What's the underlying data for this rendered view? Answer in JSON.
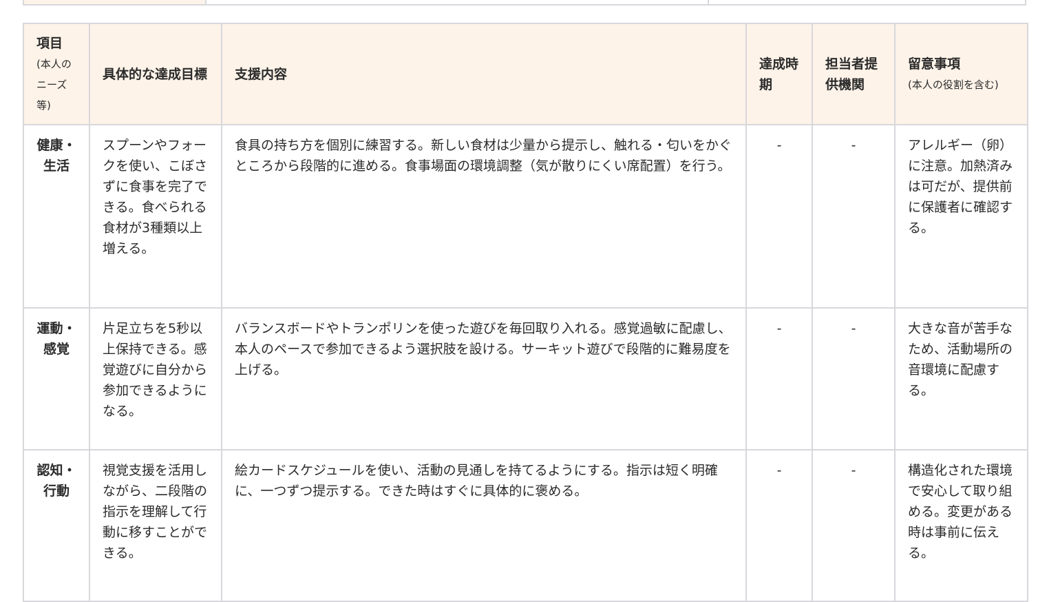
{
  "headers": {
    "item": "項目",
    "item_sub": "(本人のニーズ等)",
    "goal": "具体的な達成目標",
    "support": "支援内容",
    "period": "達成時期",
    "provider": "担当者提供機関",
    "notes": "留意事項",
    "notes_sub": "(本人の役割を含む)"
  },
  "rows": [
    {
      "item": "健康・生活",
      "goal": "スプーンやフォークを使い、こぼさずに食事を完了できる。食べられる食材が3種類以上増える。",
      "support": "食具の持ち方を個別に練習する。新しい食材は少量から提示し、触れる・匂いをかぐところから段階的に進める。食事場面の環境調整（気が散りにくい席配置）を行う。",
      "period": "-",
      "provider": "-",
      "notes": "アレルギー（卵）に注意。加熱済みは可だが、提供前に保護者に確認する。"
    },
    {
      "item": "運動・感覚",
      "goal": "片足立ちを5秒以上保持できる。感覚遊びに自分から参加できるようになる。",
      "support": "バランスボードやトランポリンを使った遊びを毎回取り入れる。感覚過敏に配慮し、本人のペースで参加できるよう選択肢を設ける。サーキット遊びで段階的に難易度を上げる。",
      "period": "-",
      "provider": "-",
      "notes": "大きな音が苦手なため、活動場所の音環境に配慮する。"
    },
    {
      "item": "認知・行動",
      "goal": "視覚支援を活用しながら、二段階の指示を理解して行動に移すことができる。",
      "support": "絵カードスケジュールを使い、活動の見通しを持てるようにする。指示は短く明確に、一つずつ提示する。できた時はすぐに具体的に褒める。",
      "period": "-",
      "provider": "-",
      "notes": "構造化された環境で安心して取り組める。変更がある時は事前に伝える。"
    }
  ]
}
